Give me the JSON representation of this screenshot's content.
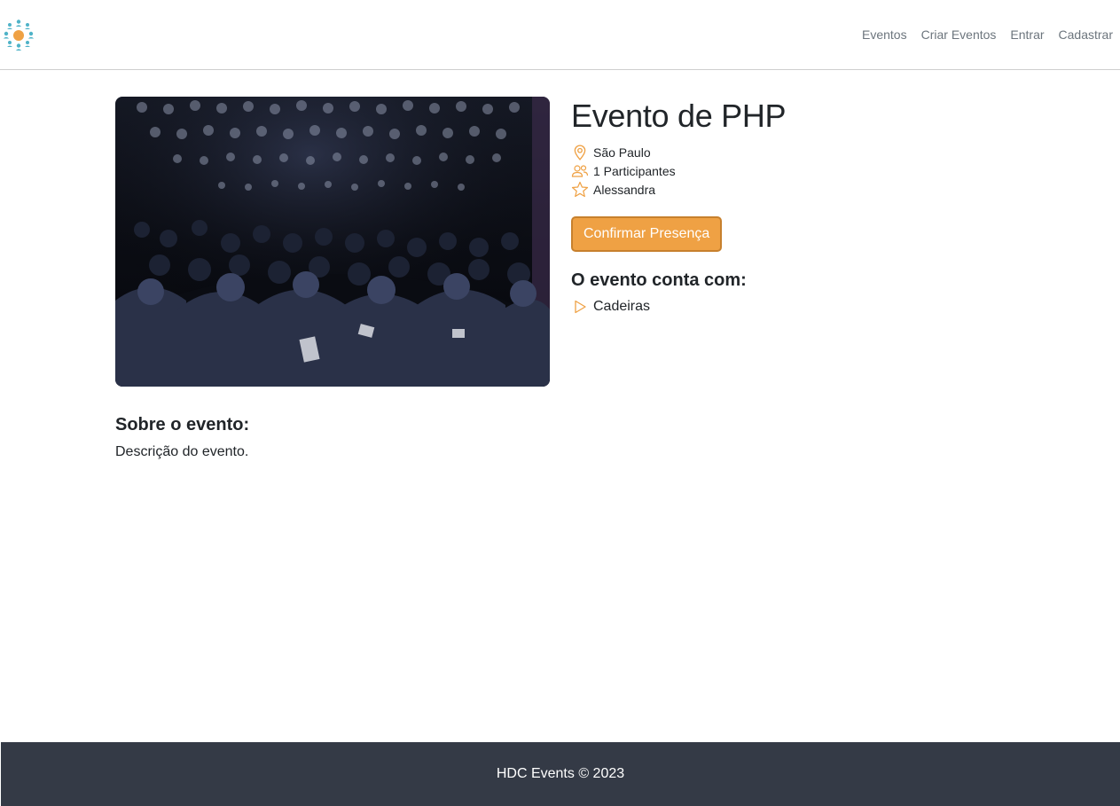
{
  "navbar": {
    "logo_icon": "people-network-logo",
    "links": [
      {
        "label": "Eventos"
      },
      {
        "label": "Criar Eventos"
      },
      {
        "label": "Entrar"
      },
      {
        "label": "Cadastrar"
      }
    ]
  },
  "event": {
    "image_icon": "conference-audience-photo",
    "title": "Evento de PHP",
    "city": "São Paulo",
    "participants": "1 Participantes",
    "owner": "Alessandra",
    "confirm_label": "Confirmar Presença",
    "features_title": "O evento conta com:",
    "features": [
      {
        "label": "Cadeiras"
      }
    ]
  },
  "about": {
    "title": "Sobre o evento:",
    "description": "Descrição do evento."
  },
  "footer": {
    "text": "HDC Events © 2023"
  },
  "colors": {
    "accent": "#efa144",
    "accent_border": "#c7802d",
    "footer_bg": "#343a46",
    "icon_teal": "#4fb3c8"
  }
}
